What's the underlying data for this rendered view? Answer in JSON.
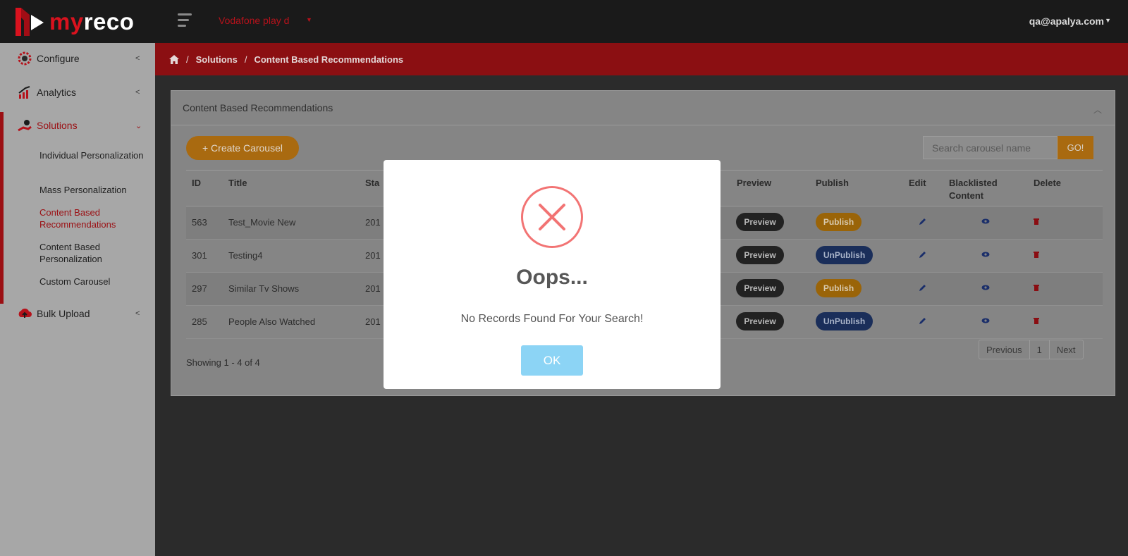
{
  "header": {
    "logo_my": "my",
    "logo_reco": "reco",
    "tenant": "Vodafone play d",
    "user": "qa@apalya.com"
  },
  "sidebar": {
    "items": [
      {
        "label": "Configure",
        "icon": "gear-icon"
      },
      {
        "label": "Analytics",
        "icon": "chart-icon"
      },
      {
        "label": "Solutions",
        "icon": "hand-gear-icon"
      },
      {
        "label": "Bulk Upload",
        "icon": "cloud-upload-icon"
      }
    ],
    "sub_items": [
      "Individual Personalization",
      "Mass Personalization",
      "Content Based Recommendations",
      "Content Based Personalization",
      "Custom Carousel"
    ]
  },
  "breadcrumb": [
    "Solutions",
    "Content Based Recommendations"
  ],
  "panel": {
    "title": "Content Based Recommendations",
    "create_label": "+ Create Carousel",
    "search_placeholder": "Search carousel name",
    "go_label": "GO!"
  },
  "table": {
    "headers": {
      "id": "ID",
      "title": "Title",
      "start": "Sta",
      "preview": "Preview",
      "publish": "Publish",
      "edit": "Edit",
      "blacklisted": "Blacklisted Content",
      "delete": "Delete"
    },
    "rows": [
      {
        "id": "563",
        "title": "Test_Movie New",
        "start": "201",
        "preview": "Preview",
        "publish": "Publish"
      },
      {
        "id": "301",
        "title": "Testing4",
        "start": "201",
        "preview": "Preview",
        "publish": "UnPublish"
      },
      {
        "id": "297",
        "title": "Similar Tv Shows",
        "start": "201",
        "preview": "Preview",
        "publish": "Publish"
      },
      {
        "id": "285",
        "title": "People Also Watched",
        "start": "201",
        "preview": "Preview",
        "publish": "UnPublish"
      }
    ],
    "showing": "Showing 1 - 4 of 4",
    "pager": {
      "previous": "Previous",
      "page": "1",
      "next": "Next"
    }
  },
  "modal": {
    "title": "Oops...",
    "text": "No Records Found For Your Search!",
    "ok": "OK"
  },
  "colors": {
    "brand_red": "#d9121e",
    "error_ring": "#f27474",
    "ok_button": "#8cd4f5"
  }
}
